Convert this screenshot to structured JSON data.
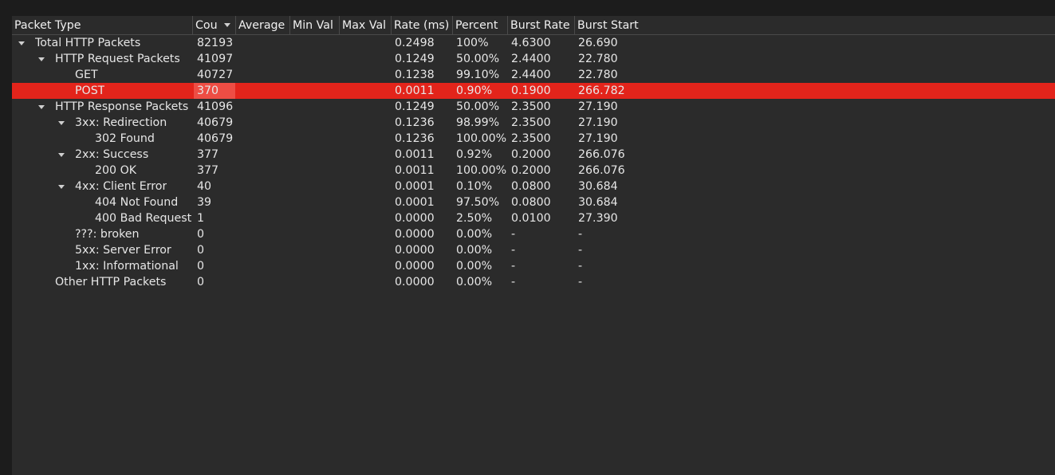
{
  "columns": [
    {
      "label": "Packet Type"
    },
    {
      "label": "Cou"
    },
    {
      "label": "Average"
    },
    {
      "label": "Min Val"
    },
    {
      "label": "Max Val"
    },
    {
      "label": "Rate (ms)"
    },
    {
      "label": "Percent"
    },
    {
      "label": "Burst Rate"
    },
    {
      "label": "Burst Start"
    }
  ],
  "rows": [
    {
      "depth": 0,
      "expanded": true,
      "type": "Total HTTP Packets",
      "count": "82193",
      "rate": "0.2498",
      "percent": "100%",
      "burst_rate": "4.6300",
      "burst_start": "26.690",
      "selected": false
    },
    {
      "depth": 1,
      "expanded": true,
      "type": "HTTP Request Packets",
      "count": "41097",
      "rate": "0.1249",
      "percent": "50.00%",
      "burst_rate": "2.4400",
      "burst_start": "22.780",
      "selected": false
    },
    {
      "depth": 2,
      "expanded": null,
      "type": "GET",
      "count": "40727",
      "rate": "0.1238",
      "percent": "99.10%",
      "burst_rate": "2.4400",
      "burst_start": "22.780",
      "selected": false
    },
    {
      "depth": 2,
      "expanded": null,
      "type": "POST",
      "count": "370",
      "rate": "0.0011",
      "percent": "0.90%",
      "burst_rate": "0.1900",
      "burst_start": "266.782",
      "selected": true
    },
    {
      "depth": 1,
      "expanded": true,
      "type": "HTTP Response Packets",
      "count": "41096",
      "rate": "0.1249",
      "percent": "50.00%",
      "burst_rate": "2.3500",
      "burst_start": "27.190",
      "selected": false
    },
    {
      "depth": 2,
      "expanded": true,
      "type": "3xx: Redirection",
      "count": "40679",
      "rate": "0.1236",
      "percent": "98.99%",
      "burst_rate": "2.3500",
      "burst_start": "27.190",
      "selected": false
    },
    {
      "depth": 3,
      "expanded": null,
      "type": "302 Found",
      "count": "40679",
      "rate": "0.1236",
      "percent": "100.00%",
      "burst_rate": "2.3500",
      "burst_start": "27.190",
      "selected": false
    },
    {
      "depth": 2,
      "expanded": true,
      "type": "2xx: Success",
      "count": "377",
      "rate": "0.0011",
      "percent": "0.92%",
      "burst_rate": "0.2000",
      "burst_start": "266.076",
      "selected": false
    },
    {
      "depth": 3,
      "expanded": null,
      "type": "200 OK",
      "count": "377",
      "rate": "0.0011",
      "percent": "100.00%",
      "burst_rate": "0.2000",
      "burst_start": "266.076",
      "selected": false
    },
    {
      "depth": 2,
      "expanded": true,
      "type": "4xx: Client Error",
      "count": "40",
      "rate": "0.0001",
      "percent": "0.10%",
      "burst_rate": "0.0800",
      "burst_start": "30.684",
      "selected": false
    },
    {
      "depth": 3,
      "expanded": null,
      "type": "404 Not Found",
      "count": "39",
      "rate": "0.0001",
      "percent": "97.50%",
      "burst_rate": "0.0800",
      "burst_start": "30.684",
      "selected": false
    },
    {
      "depth": 3,
      "expanded": null,
      "type": "400 Bad Request",
      "count": "1",
      "rate": "0.0000",
      "percent": "2.50%",
      "burst_rate": "0.0100",
      "burst_start": "27.390",
      "selected": false
    },
    {
      "depth": 2,
      "expanded": null,
      "type": "???: broken",
      "count": "0",
      "rate": "0.0000",
      "percent": "0.00%",
      "burst_rate": "-",
      "burst_start": "-",
      "selected": false
    },
    {
      "depth": 2,
      "expanded": null,
      "type": "5xx: Server Error",
      "count": "0",
      "rate": "0.0000",
      "percent": "0.00%",
      "burst_rate": "-",
      "burst_start": "-",
      "selected": false
    },
    {
      "depth": 2,
      "expanded": null,
      "type": "1xx: Informational",
      "count": "0",
      "rate": "0.0000",
      "percent": "0.00%",
      "burst_rate": "-",
      "burst_start": "-",
      "selected": false
    },
    {
      "depth": 1,
      "expanded": null,
      "type": "Other HTTP Packets",
      "count": "0",
      "rate": "0.0000",
      "percent": "0.00%",
      "burst_rate": "-",
      "burst_start": "-",
      "selected": false
    }
  ],
  "colors": {
    "selection": "#e3241b",
    "background": "#2b2b2b",
    "text": "#e6e6e6"
  },
  "icons": {
    "sort": "sort-descending-icon",
    "expand": "expanded-triangle-icon"
  }
}
